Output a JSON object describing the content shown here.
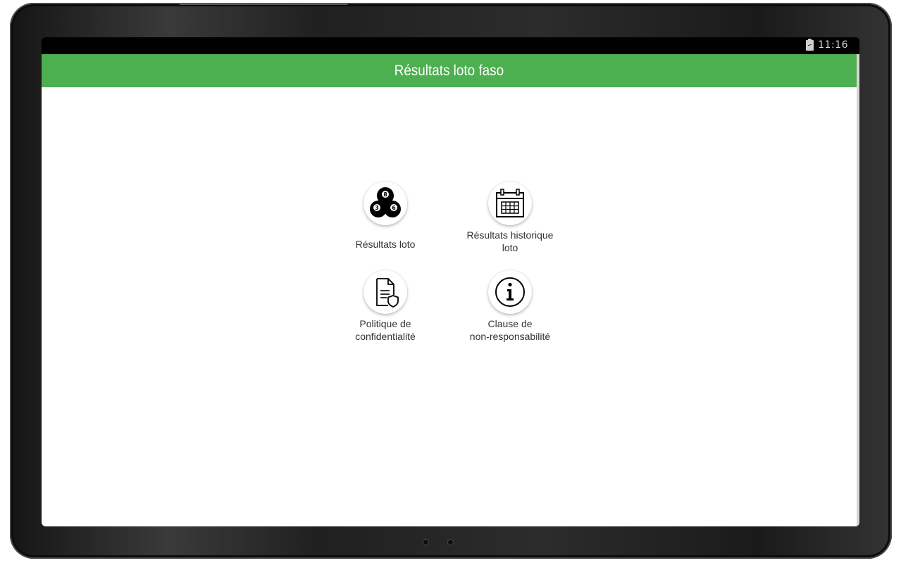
{
  "status_bar": {
    "time": "11:16",
    "battery_icon": "battery-charging-icon"
  },
  "app_bar": {
    "title": "Résultats loto faso",
    "color": "#4caf50"
  },
  "menu": [
    {
      "label": "Résultats loto",
      "icon": "billiard-balls-icon"
    },
    {
      "label": "Résultats historique\nloto",
      "icon": "calendar-icon"
    },
    {
      "label": "Politique de\nconfidentialité",
      "icon": "document-shield-icon"
    },
    {
      "label": "Clause de\nnon-responsabilité",
      "icon": "info-icon"
    }
  ]
}
